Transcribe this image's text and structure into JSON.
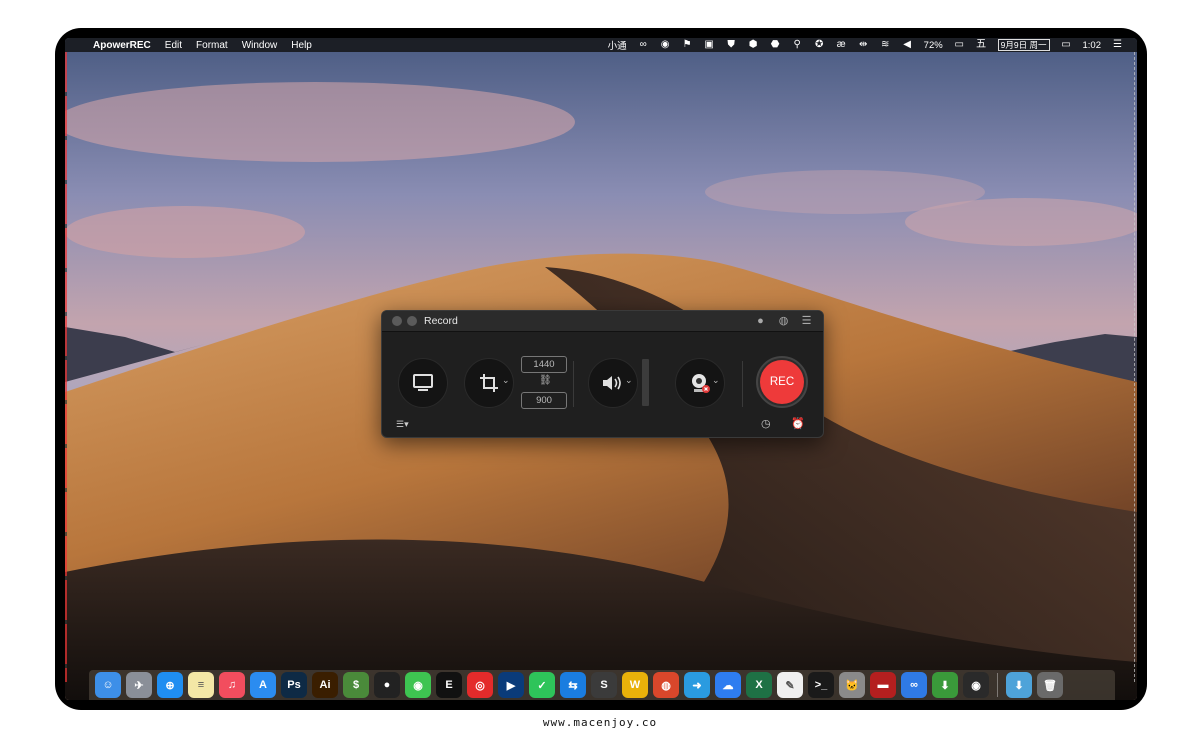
{
  "menubar": {
    "app_name": "ApowerREC",
    "menus": [
      "Edit",
      "Format",
      "Window",
      "Help"
    ],
    "status_text_1": "小通",
    "battery": "72%",
    "date": "9月9日 周一",
    "time": "1:02"
  },
  "window": {
    "title": "Record",
    "width_value": "1440",
    "height_value": "900",
    "rec_label": "REC"
  },
  "dock": {
    "items": [
      {
        "name": "finder",
        "color": "#3d8fe8",
        "glyph": "☺"
      },
      {
        "name": "launchpad",
        "color": "#8a8f98",
        "glyph": "✈"
      },
      {
        "name": "safari",
        "color": "#1f8ef1",
        "glyph": "⊕"
      },
      {
        "name": "notes",
        "color": "#f3e7a6",
        "glyph": "≡"
      },
      {
        "name": "music",
        "color": "#f24d5e",
        "glyph": "♫"
      },
      {
        "name": "app-store",
        "color": "#2b8cf0",
        "glyph": "A"
      },
      {
        "name": "photoshop",
        "color": "#0e2a45",
        "glyph": "Ps"
      },
      {
        "name": "illustrator",
        "color": "#3a1e00",
        "glyph": "Ai"
      },
      {
        "name": "money",
        "color": "#4a8a3a",
        "glyph": "$"
      },
      {
        "name": "qq",
        "color": "#222222",
        "glyph": "●"
      },
      {
        "name": "wechat",
        "color": "#3ec451",
        "glyph": "◉"
      },
      {
        "name": "enjoy",
        "color": "#111111",
        "glyph": "E"
      },
      {
        "name": "netease-music",
        "color": "#e42b2b",
        "glyph": "◎"
      },
      {
        "name": "audio",
        "color": "#0a3b7a",
        "glyph": "▶"
      },
      {
        "name": "touch",
        "color": "#2ec45a",
        "glyph": "✓"
      },
      {
        "name": "teamviewer",
        "color": "#1a7de0",
        "glyph": "⇆"
      },
      {
        "name": "sublime",
        "color": "#3b3b3b",
        "glyph": "S"
      },
      {
        "name": "vpn",
        "color": "#e9b10a",
        "glyph": "W"
      },
      {
        "name": "chrome",
        "color": "#d9472b",
        "glyph": "◍"
      },
      {
        "name": "transfer",
        "color": "#2a9be0",
        "glyph": "➜"
      },
      {
        "name": "cloud",
        "color": "#2e7df0",
        "glyph": "☁"
      },
      {
        "name": "excel",
        "color": "#1e7145",
        "glyph": "X"
      },
      {
        "name": "textedit",
        "color": "#f0f0f0",
        "glyph": "✎"
      },
      {
        "name": "terminal",
        "color": "#1a1a1a",
        "glyph": ">_"
      },
      {
        "name": "cat",
        "color": "#8a8a8a",
        "glyph": "🐱"
      },
      {
        "name": "monitor",
        "color": "#b41f1f",
        "glyph": "▬"
      },
      {
        "name": "baidu-netdisk",
        "color": "#2f7ae5",
        "glyph": "∞"
      },
      {
        "name": "installer",
        "color": "#3a9a3a",
        "glyph": "⬇"
      },
      {
        "name": "apowerrec",
        "color": "#2a2a2a",
        "glyph": "◉"
      },
      {
        "name": "downloads-folder",
        "color": "#4ea3d9",
        "glyph": "⬇"
      },
      {
        "name": "trash",
        "color": "#6a6a6a",
        "glyph": "🗑"
      }
    ]
  },
  "footer": {
    "watermark": "www.macenjoy.co"
  }
}
